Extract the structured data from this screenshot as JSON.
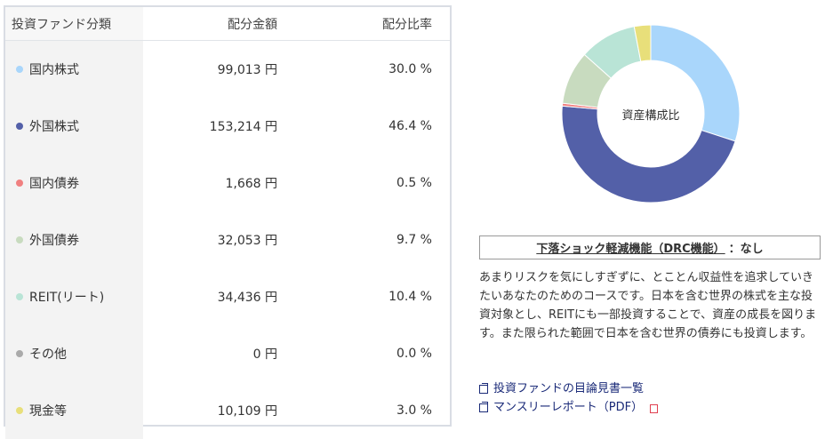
{
  "table": {
    "headers": [
      "投資ファンド分類",
      "配分金額",
      "配分比率"
    ],
    "rows": [
      {
        "name": "国内株式",
        "amount": "99,013 円",
        "ratio": "30.0 %",
        "color": "#a9d6fb"
      },
      {
        "name": "外国株式",
        "amount": "153,214 円",
        "ratio": "46.4 %",
        "color": "#5360a8"
      },
      {
        "name": "国内債券",
        "amount": "1,668 円",
        "ratio": "0.5 %",
        "color": "#f08080"
      },
      {
        "name": "外国債券",
        "amount": "32,053 円",
        "ratio": "9.7 %",
        "color": "#c8dbbf"
      },
      {
        "name": "REIT(リート)",
        "amount": "34,436 円",
        "ratio": "10.4 %",
        "color": "#b9e4d6"
      },
      {
        "name": "その他",
        "amount": "0 円",
        "ratio": "0.0 %",
        "color": "#aaaaaa"
      },
      {
        "name": "現金等",
        "amount": "10,109 円",
        "ratio": "3.0 %",
        "color": "#e8df7a"
      }
    ]
  },
  "chart_data": {
    "type": "pie",
    "title": "資産構成比",
    "categories": [
      "国内株式",
      "外国株式",
      "国内債券",
      "外国債券",
      "REIT(リート)",
      "その他",
      "現金等"
    ],
    "values": [
      30.0,
      46.4,
      0.5,
      9.7,
      10.4,
      0.0,
      3.0
    ],
    "colors": [
      "#a9d6fb",
      "#5360a8",
      "#f08080",
      "#c8dbbf",
      "#b9e4d6",
      "#aaaaaa",
      "#e8df7a"
    ]
  },
  "drc": {
    "label": "下落ショック軽減機能（DRC機能）",
    "value": "：なし"
  },
  "description": "あまりリスクを気にしすぎずに、とことん収益性を追求していきたいあなたのためのコースです。日本を含む世界の株式を主な投資対象とし、REITにも一部投資することで、資産の成長を図ります。また限られた範囲で日本を含む世界の債券にも投資します。",
  "links": {
    "prospectus": "投資ファンドの目論見書一覧",
    "monthly_report": "マンスリーレポート（PDF）"
  }
}
